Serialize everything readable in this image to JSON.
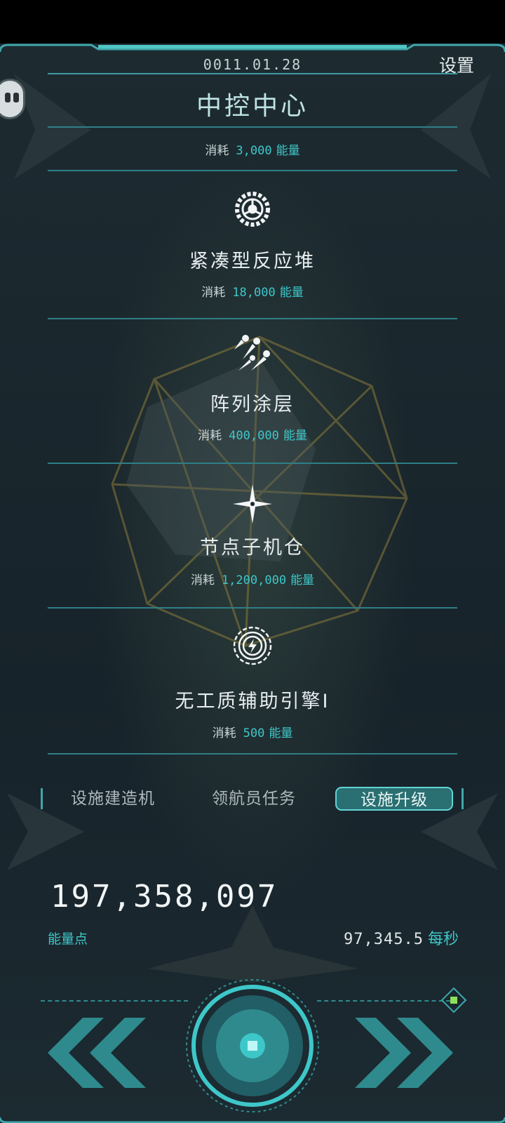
{
  "header": {
    "date": "0011.01.28",
    "title": "中控中心",
    "settings_label": "设置"
  },
  "cost_label": "消耗",
  "items": [
    {
      "name": "中控中心",
      "cost_value": "3,000",
      "cost_unit": "能量",
      "icon": "none"
    },
    {
      "name": "紧凑型反应堆",
      "cost_value": "18,000",
      "cost_unit": "能量",
      "icon": "reactor-gear-icon"
    },
    {
      "name": "阵列涂层",
      "cost_value": "400,000",
      "cost_unit": "能量",
      "icon": "missile-array-icon"
    },
    {
      "name": "节点子机仓",
      "cost_value": "1,200,000",
      "cost_unit": "能量",
      "icon": "sparkle-star-icon"
    },
    {
      "name": "无工质辅助引擎I",
      "cost_value": "500",
      "cost_unit": "能量",
      "icon": "lightning-gear-icon"
    }
  ],
  "tabs": [
    {
      "label": "设施建造机",
      "active": false
    },
    {
      "label": "领航员任务",
      "active": false
    },
    {
      "label": "设施升级",
      "active": true
    }
  ],
  "resources": {
    "energy_total": "197,358,097",
    "energy_label": "能量点",
    "rate_value": "97,345.5",
    "rate_unit": "每秒"
  },
  "colors": {
    "accent": "#3ec7c9",
    "background": "#1a262c",
    "tab_active": "#2a6f72"
  }
}
